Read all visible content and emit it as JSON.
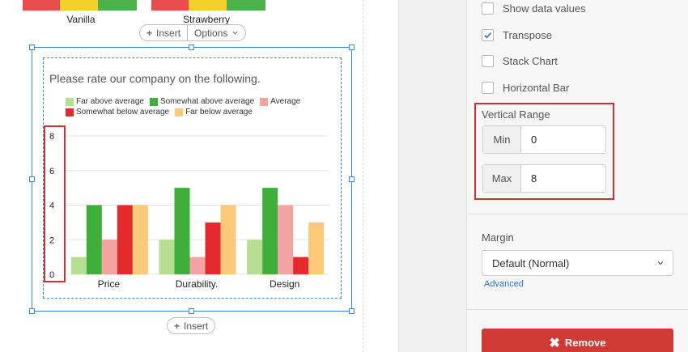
{
  "preview": {
    "labels": [
      "Vanilla",
      "Strawberry"
    ]
  },
  "top_toolbar": {
    "insert_label": "Insert",
    "options_label": "Options"
  },
  "bottom_toolbar": {
    "insert_label": "Insert"
  },
  "chart_data": {
    "type": "bar",
    "title": "Please rate our company on the following.",
    "categories": [
      "Price",
      "Durability.",
      "Design"
    ],
    "series": [
      {
        "name": "Far above average",
        "color": "#b7df92",
        "values": [
          1,
          2,
          2
        ]
      },
      {
        "name": "Somewhat above average",
        "color": "#3fae3a",
        "values": [
          4,
          5,
          5
        ]
      },
      {
        "name": "Average",
        "color": "#f4a3a3",
        "values": [
          2,
          1,
          4
        ]
      },
      {
        "name": "Somewhat below average",
        "color": "#e52a2d",
        "values": [
          4,
          3,
          1
        ]
      },
      {
        "name": "Far below average",
        "color": "#fcc97a",
        "values": [
          4,
          4,
          3
        ]
      }
    ],
    "ylim": [
      0,
      8
    ],
    "yticks": [
      "0",
      "2",
      "4",
      "6",
      "8"
    ],
    "grid": true,
    "legend_position": "top"
  },
  "options": {
    "show_data_values": {
      "label": "Show data values",
      "checked": false
    },
    "transpose": {
      "label": "Transpose",
      "checked": true
    },
    "stack_chart": {
      "label": "Stack Chart",
      "checked": false
    },
    "horizontal_bar": {
      "label": "Horizontal Bar",
      "checked": false
    }
  },
  "vertical_range": {
    "label": "Vertical Range",
    "min_label": "Min",
    "min_value": "0",
    "max_label": "Max",
    "max_value": "8"
  },
  "margin": {
    "label": "Margin",
    "selected": "Default (Normal)",
    "advanced_link": "Advanced"
  },
  "remove_button": {
    "label": "Remove"
  },
  "colors": {
    "accent": "#3b87d6",
    "highlight": "#c33538",
    "remove": "#d03a34",
    "link": "#2f74c8",
    "preview_red": "#e84c4c",
    "preview_yellow": "#f3d12a",
    "preview_green": "#4db04a"
  }
}
